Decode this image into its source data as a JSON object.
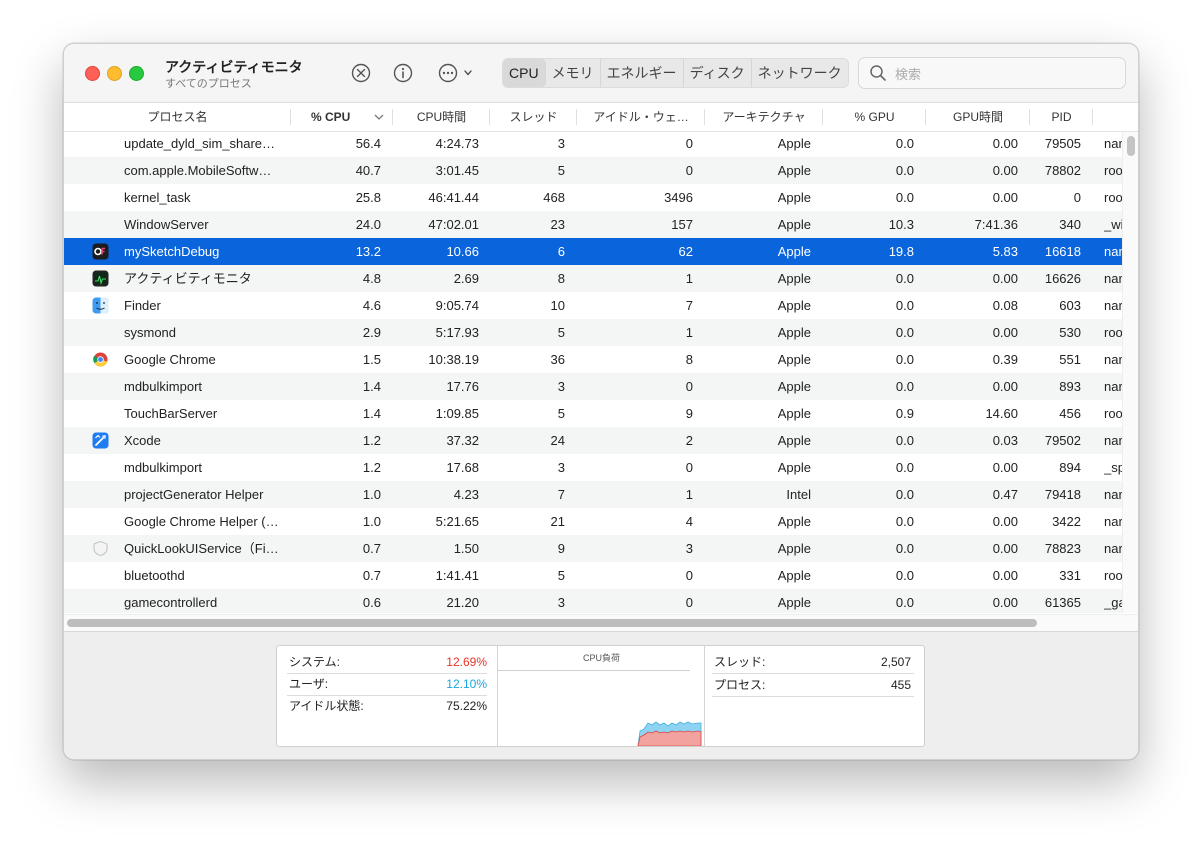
{
  "window": {
    "title": "アクティビティモニタ",
    "subtitle": "すべてのプロセス"
  },
  "toolbar": {
    "stop_icon": "x-circle-icon",
    "info_icon": "info-circle-icon",
    "more_icon": "ellipsis-circle-icon",
    "tabs": [
      "CPU",
      "メモリ",
      "エネルギー",
      "ディスク",
      "ネットワーク"
    ],
    "active_tab": "CPU",
    "search_placeholder": "検索"
  },
  "columns": [
    "プロセス名",
    "% CPU",
    "CPU時間",
    "スレッド",
    "アイドル・ウェ…",
    "アーキテクチャ",
    "% GPU",
    "GPU時間",
    "PID"
  ],
  "sort_column": "% CPU",
  "processes": [
    {
      "name": "update_dyld_sim_share…",
      "cpu": "56.4",
      "cpu_time": "4:24.73",
      "threads": "3",
      "idle_wake": "0",
      "arch": "Apple",
      "gpu": "0.0",
      "gpu_time": "0.00",
      "pid": "79505",
      "user": "nar",
      "icon": ""
    },
    {
      "name": "com.apple.MobileSoftw…",
      "cpu": "40.7",
      "cpu_time": "3:01.45",
      "threads": "5",
      "idle_wake": "0",
      "arch": "Apple",
      "gpu": "0.0",
      "gpu_time": "0.00",
      "pid": "78802",
      "user": "roo",
      "icon": ""
    },
    {
      "name": "kernel_task",
      "cpu": "25.8",
      "cpu_time": "46:41.44",
      "threads": "468",
      "idle_wake": "3496",
      "arch": "Apple",
      "gpu": "0.0",
      "gpu_time": "0.00",
      "pid": "0",
      "user": "roo",
      "icon": ""
    },
    {
      "name": "WindowServer",
      "cpu": "24.0",
      "cpu_time": "47:02.01",
      "threads": "23",
      "idle_wake": "157",
      "arch": "Apple",
      "gpu": "10.3",
      "gpu_time": "7:41.36",
      "pid": "340",
      "user": "_wi",
      "icon": ""
    },
    {
      "name": "mySketchDebug",
      "cpu": "13.2",
      "cpu_time": "10.66",
      "threads": "6",
      "idle_wake": "62",
      "arch": "Apple",
      "gpu": "19.8",
      "gpu_time": "5.83",
      "pid": "16618",
      "user": "nar",
      "icon": "of-app-icon",
      "selected": true
    },
    {
      "name": "アクティビティモニタ",
      "cpu": "4.8",
      "cpu_time": "2.69",
      "threads": "8",
      "idle_wake": "1",
      "arch": "Apple",
      "gpu": "0.0",
      "gpu_time": "0.00",
      "pid": "16626",
      "user": "nar",
      "icon": "activity-monitor-icon"
    },
    {
      "name": "Finder",
      "cpu": "4.6",
      "cpu_time": "9:05.74",
      "threads": "10",
      "idle_wake": "7",
      "arch": "Apple",
      "gpu": "0.0",
      "gpu_time": "0.08",
      "pid": "603",
      "user": "nar",
      "icon": "finder-icon"
    },
    {
      "name": "sysmond",
      "cpu": "2.9",
      "cpu_time": "5:17.93",
      "threads": "5",
      "idle_wake": "1",
      "arch": "Apple",
      "gpu": "0.0",
      "gpu_time": "0.00",
      "pid": "530",
      "user": "roo",
      "icon": ""
    },
    {
      "name": "Google Chrome",
      "cpu": "1.5",
      "cpu_time": "10:38.19",
      "threads": "36",
      "idle_wake": "8",
      "arch": "Apple",
      "gpu": "0.0",
      "gpu_time": "0.39",
      "pid": "551",
      "user": "nar",
      "icon": "chrome-icon"
    },
    {
      "name": "mdbulkimport",
      "cpu": "1.4",
      "cpu_time": "17.76",
      "threads": "3",
      "idle_wake": "0",
      "arch": "Apple",
      "gpu": "0.0",
      "gpu_time": "0.00",
      "pid": "893",
      "user": "nar",
      "icon": ""
    },
    {
      "name": "TouchBarServer",
      "cpu": "1.4",
      "cpu_time": "1:09.85",
      "threads": "5",
      "idle_wake": "9",
      "arch": "Apple",
      "gpu": "0.9",
      "gpu_time": "14.60",
      "pid": "456",
      "user": "roo",
      "icon": ""
    },
    {
      "name": "Xcode",
      "cpu": "1.2",
      "cpu_time": "37.32",
      "threads": "24",
      "idle_wake": "2",
      "arch": "Apple",
      "gpu": "0.0",
      "gpu_time": "0.03",
      "pid": "79502",
      "user": "nar",
      "icon": "xcode-icon"
    },
    {
      "name": "mdbulkimport",
      "cpu": "1.2",
      "cpu_time": "17.68",
      "threads": "3",
      "idle_wake": "0",
      "arch": "Apple",
      "gpu": "0.0",
      "gpu_time": "0.00",
      "pid": "894",
      "user": "_sp",
      "icon": ""
    },
    {
      "name": "projectGenerator Helper",
      "cpu": "1.0",
      "cpu_time": "4.23",
      "threads": "7",
      "idle_wake": "1",
      "arch": "Intel",
      "gpu": "0.0",
      "gpu_time": "0.47",
      "pid": "79418",
      "user": "nar",
      "icon": ""
    },
    {
      "name": "Google Chrome Helper (…",
      "cpu": "1.0",
      "cpu_time": "5:21.65",
      "threads": "21",
      "idle_wake": "4",
      "arch": "Apple",
      "gpu": "0.0",
      "gpu_time": "0.00",
      "pid": "3422",
      "user": "nar",
      "icon": ""
    },
    {
      "name": "QuickLookUIService（Fi…",
      "cpu": "0.7",
      "cpu_time": "1.50",
      "threads": "9",
      "idle_wake": "3",
      "arch": "Apple",
      "gpu": "0.0",
      "gpu_time": "0.00",
      "pid": "78823",
      "user": "nar",
      "icon": "shield-icon"
    },
    {
      "name": "bluetoothd",
      "cpu": "0.7",
      "cpu_time": "1:41.41",
      "threads": "5",
      "idle_wake": "0",
      "arch": "Apple",
      "gpu": "0.0",
      "gpu_time": "0.00",
      "pid": "331",
      "user": "roo",
      "icon": ""
    },
    {
      "name": "gamecontrollerd",
      "cpu": "0.6",
      "cpu_time": "21.20",
      "threads": "3",
      "idle_wake": "0",
      "arch": "Apple",
      "gpu": "0.0",
      "gpu_time": "0.00",
      "pid": "61365",
      "user": "_ga",
      "icon": ""
    }
  ],
  "summary": {
    "system_label": "システム:",
    "system_value": "12.69%",
    "user_label": "ユーザ:",
    "user_value": "12.10%",
    "idle_label": "アイドル状態:",
    "idle_value": "75.22%",
    "chart_title": "CPU負荷",
    "threads_label": "スレッド:",
    "threads_value": "2,507",
    "processes_label": "プロセス:",
    "processes_value": "455",
    "system_color": "#e8332a",
    "user_color": "#1aa6e0"
  }
}
